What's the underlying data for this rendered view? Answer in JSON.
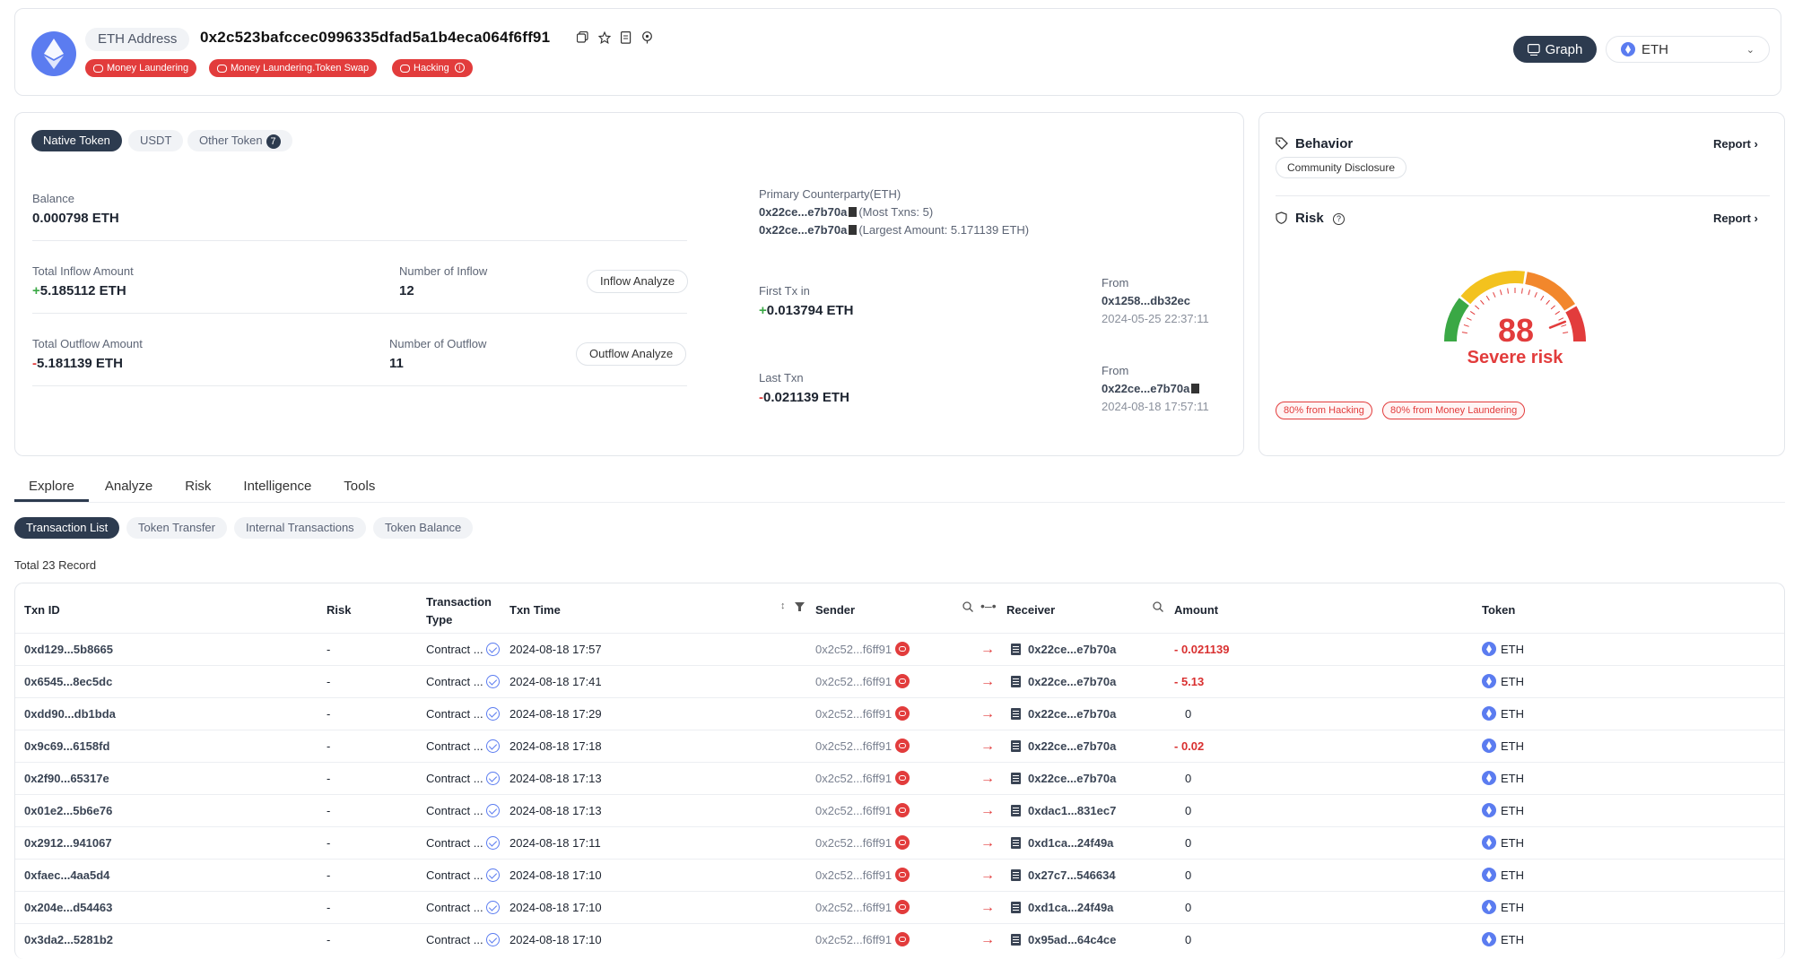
{
  "header": {
    "address_type": "ETH Address",
    "address": "0x2c523bafccec0996335dfad5a1b4eca064f6ff91",
    "tags": [
      "Money Laundering",
      "Money Laundering.Token Swap",
      "Hacking"
    ],
    "graph_label": "Graph",
    "chain_select": "ETH"
  },
  "tokens": {
    "tabs": [
      "Native Token",
      "USDT",
      "Other Token"
    ],
    "other_count": "7"
  },
  "summary": {
    "balance_label": "Balance",
    "balance": "0.000798 ETH",
    "inflow_label": "Total Inflow Amount",
    "inflow_sign": "+",
    "inflow": "5.185112 ETH",
    "inflow_count_label": "Number of Inflow",
    "inflow_count": "12",
    "inflow_btn": "Inflow Analyze",
    "outflow_label": "Total Outflow Amount",
    "outflow_sign": "-",
    "outflow": "5.181139 ETH",
    "outflow_count_label": "Number of Outflow",
    "outflow_count": "11",
    "outflow_btn": "Outflow Analyze",
    "primary_label": "Primary Counterparty(ETH)",
    "primary_1_addr": "0x22ce...e7b70a",
    "primary_1_note": "(Most Txns: 5)",
    "primary_2_addr": "0x22ce...e7b70a",
    "primary_2_note": "(Largest Amount: 5.171139 ETH)",
    "first_label": "First Tx in",
    "first_sign": "+",
    "first_amount": "0.013794 ETH",
    "first_from_label": "From",
    "first_from": "0x1258...db32ec",
    "first_time": "2024-05-25 22:37:11",
    "last_label": "Last Txn",
    "last_sign": "-",
    "last_amount": "0.021139 ETH",
    "last_from_label": "From",
    "last_from": "0x22ce...e7b70a",
    "last_time": "2024-08-18 17:57:11"
  },
  "side": {
    "behavior_title": "Behavior",
    "report_label": "Report",
    "community": "Community Disclosure",
    "risk_title": "Risk",
    "score": "88",
    "score_value": 88,
    "risk_level": "Severe risk",
    "risk_tags": [
      "80% from Hacking",
      "80% from Money Laundering"
    ],
    "colors": {
      "green": "#3aa845",
      "yellow": "#f3c21e",
      "orange": "#f2872c",
      "red": "#e23c3c"
    }
  },
  "nav": {
    "tabs": [
      "Explore",
      "Analyze",
      "Risk",
      "Intelligence",
      "Tools"
    ],
    "subtabs": [
      "Transaction List",
      "Token Transfer",
      "Internal Transactions",
      "Token Balance"
    ],
    "total": "Total 23 Record"
  },
  "table": {
    "headers": {
      "txid": "Txn ID",
      "risk": "Risk",
      "type_1": "Transaction",
      "type_2": "Type",
      "time": "Txn Time",
      "sender": "Sender",
      "receiver": "Receiver",
      "amount": "Amount",
      "token": "Token"
    },
    "rows": [
      {
        "txid": "0xd129...5b8665",
        "risk": "-",
        "type": "Contract ...",
        "time": "2024-08-18 17:57",
        "sender": "0x2c52...f6ff91",
        "receiver": "0x22ce...e7b70a",
        "amount": "- 0.021139",
        "neg": true,
        "token": "ETH"
      },
      {
        "txid": "0x6545...8ec5dc",
        "risk": "-",
        "type": "Contract ...",
        "time": "2024-08-18 17:41",
        "sender": "0x2c52...f6ff91",
        "receiver": "0x22ce...e7b70a",
        "amount": "- 5.13",
        "neg": true,
        "token": "ETH"
      },
      {
        "txid": "0xdd90...db1bda",
        "risk": "-",
        "type": "Contract ...",
        "time": "2024-08-18 17:29",
        "sender": "0x2c52...f6ff91",
        "receiver": "0x22ce...e7b70a",
        "amount": "0",
        "neg": false,
        "token": "ETH"
      },
      {
        "txid": "0x9c69...6158fd",
        "risk": "-",
        "type": "Contract ...",
        "time": "2024-08-18 17:18",
        "sender": "0x2c52...f6ff91",
        "receiver": "0x22ce...e7b70a",
        "amount": "- 0.02",
        "neg": true,
        "token": "ETH"
      },
      {
        "txid": "0x2f90...65317e",
        "risk": "-",
        "type": "Contract ...",
        "time": "2024-08-18 17:13",
        "sender": "0x2c52...f6ff91",
        "receiver": "0x22ce...e7b70a",
        "amount": "0",
        "neg": false,
        "token": "ETH"
      },
      {
        "txid": "0x01e2...5b6e76",
        "risk": "-",
        "type": "Contract ...",
        "time": "2024-08-18 17:13",
        "sender": "0x2c52...f6ff91",
        "receiver": "0xdac1...831ec7",
        "amount": "0",
        "neg": false,
        "token": "ETH"
      },
      {
        "txid": "0x2912...941067",
        "risk": "-",
        "type": "Contract ...",
        "time": "2024-08-18 17:11",
        "sender": "0x2c52...f6ff91",
        "receiver": "0xd1ca...24f49a",
        "amount": "0",
        "neg": false,
        "token": "ETH"
      },
      {
        "txid": "0xfaec...4aa5d4",
        "risk": "-",
        "type": "Contract ...",
        "time": "2024-08-18 17:10",
        "sender": "0x2c52...f6ff91",
        "receiver": "0x27c7...546634",
        "amount": "0",
        "neg": false,
        "token": "ETH"
      },
      {
        "txid": "0x204e...d54463",
        "risk": "-",
        "type": "Contract ...",
        "time": "2024-08-18 17:10",
        "sender": "0x2c52...f6ff91",
        "receiver": "0xd1ca...24f49a",
        "amount": "0",
        "neg": false,
        "token": "ETH"
      },
      {
        "txid": "0x3da2...5281b2",
        "risk": "-",
        "type": "Contract ...",
        "time": "2024-08-18 17:10",
        "sender": "0x2c52...f6ff91",
        "receiver": "0x95ad...64c4ce",
        "amount": "0",
        "neg": false,
        "token": "ETH"
      }
    ]
  }
}
